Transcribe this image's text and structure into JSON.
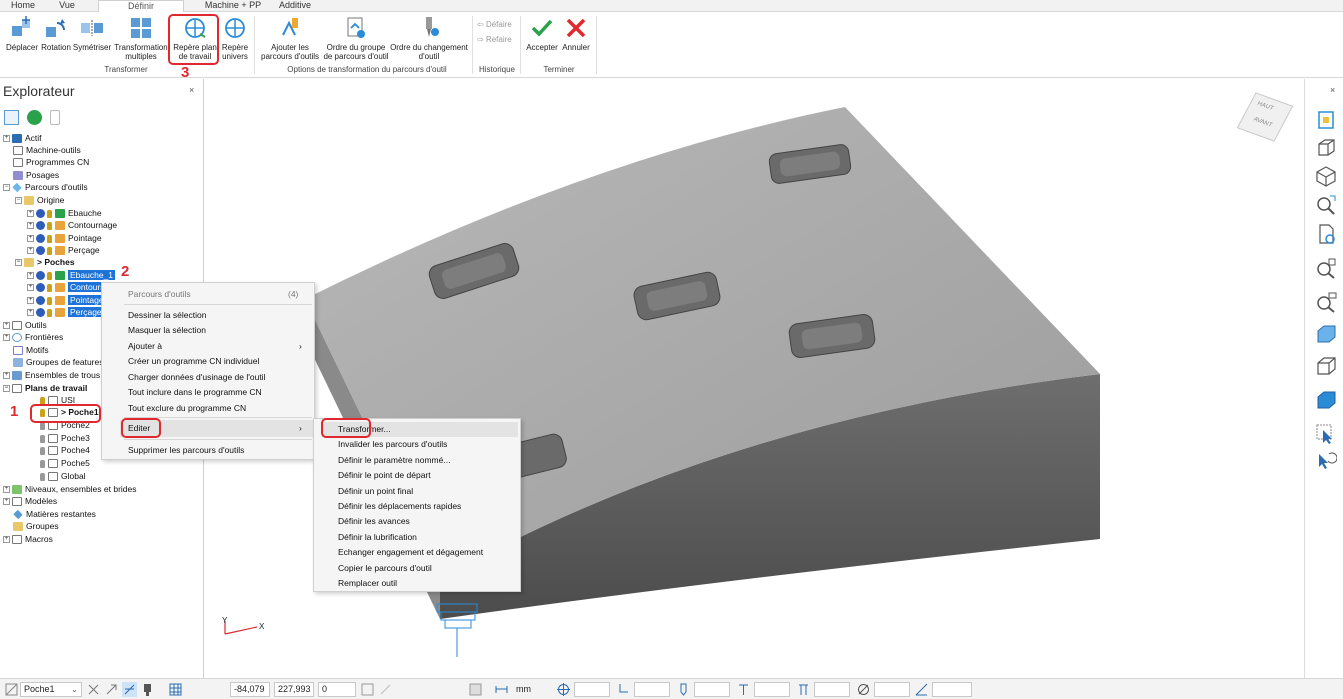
{
  "tabs": [
    {
      "label": "Home"
    },
    {
      "label": "Vue"
    },
    {
      "label": "Définir"
    },
    {
      "label": "Machine + PP"
    },
    {
      "label": "Additive"
    }
  ],
  "ribbon": {
    "buttons": [
      {
        "label": "Déplacer",
        "icon": "move-icon"
      },
      {
        "label": "Rotation",
        "icon": "rotate-icon"
      },
      {
        "label": "Symétriser",
        "icon": "mirror-icon"
      },
      {
        "label": "Transformation multiples",
        "icon": "multi-transform-icon"
      },
      {
        "label": "Repère plan de travail",
        "icon": "workplane-frame-icon"
      },
      {
        "label": "Repère univers",
        "icon": "world-frame-icon"
      },
      {
        "label": "Ajouter les parcours d'outils",
        "icon": "add-toolpaths-icon"
      },
      {
        "label": "Ordre du groupe de parcours d'outil",
        "icon": "group-order-icon"
      },
      {
        "label": "Ordre du changement d'outil",
        "icon": "tool-change-order-icon"
      },
      {
        "label": "Accepter",
        "icon": "check-icon"
      },
      {
        "label": "Annuler",
        "icon": "cancel-icon"
      }
    ],
    "history": {
      "undo": "Défaire",
      "redo": "Refaire"
    },
    "groups": {
      "transformer": "Transformer",
      "options": "Options de transformation du parcours d'outil",
      "historique": "Historique",
      "terminer": "Terminer"
    }
  },
  "explorer": {
    "title": "Explorateur",
    "close": "×",
    "tree": [
      {
        "label": "Actif"
      },
      {
        "label": "Machine-outils"
      },
      {
        "label": "Programmes CN"
      },
      {
        "label": "Posages"
      },
      {
        "label": "Parcours d'outils"
      },
      {
        "label": "Origine"
      },
      {
        "label": "Ebauche"
      },
      {
        "label": "Contournage"
      },
      {
        "label": "Pointage"
      },
      {
        "label": "Perçage"
      },
      {
        "label": "> Poches"
      },
      {
        "label": "Ebauche_1"
      },
      {
        "label": "Contournage_1"
      },
      {
        "label": "Pointage_1"
      },
      {
        "label": "Perçage_1"
      },
      {
        "label": "Outils"
      },
      {
        "label": "Frontières"
      },
      {
        "label": "Motifs"
      },
      {
        "label": "Groupes de features"
      },
      {
        "label": "Ensembles de trous"
      },
      {
        "label": "Plans de travail"
      },
      {
        "label": "USI"
      },
      {
        "label": "> Poche1"
      },
      {
        "label": "Poche2"
      },
      {
        "label": "Poche3"
      },
      {
        "label": "Poche4"
      },
      {
        "label": "Poche5"
      },
      {
        "label": "Global"
      },
      {
        "label": "Niveaux, ensembles et brides"
      },
      {
        "label": "Modèles"
      },
      {
        "label": "Matières restantes"
      },
      {
        "label": "Groupes"
      },
      {
        "label": "Macros"
      }
    ]
  },
  "context_menu": {
    "header": "Parcours d'outils",
    "count": "(4)",
    "items": [
      {
        "label": "Dessiner la sélection"
      },
      {
        "label": "Masquer la sélection"
      },
      {
        "label": "Ajouter à"
      },
      {
        "label": "Créer un programme CN individuel"
      },
      {
        "label": "Charger données d'usinage de l'outil"
      },
      {
        "label": "Tout inclure dans le programme CN"
      },
      {
        "label": "Tout exclure du programme CN"
      },
      {
        "label": "Editer"
      },
      {
        "label": "Supprimer les parcours d'outils"
      }
    ],
    "arrow": "›"
  },
  "submenu": {
    "items": [
      {
        "label": "Transformer..."
      },
      {
        "label": "Invalider les parcours d'outils"
      },
      {
        "label": "Définir le paramètre nommé..."
      },
      {
        "label": "Définir le point de départ"
      },
      {
        "label": "Définir un point final"
      },
      {
        "label": "Définir les déplacements rapides"
      },
      {
        "label": "Définir les avances"
      },
      {
        "label": "Définir la lubrification"
      },
      {
        "label": "Echanger engagement et dégagement"
      },
      {
        "label": "Copier le parcours d'outil"
      },
      {
        "label": "Remplacer outil"
      }
    ]
  },
  "callouts": {
    "n1": "1",
    "n2": "2",
    "n3": "3"
  },
  "viewcube": {
    "top": "HAUT",
    "front": "AVANT"
  },
  "axes": {
    "y": "Y",
    "x": "X"
  },
  "right_toolbar_close": "×",
  "statusbar": {
    "workplane": "Poche1",
    "coord_x": "-84,079",
    "coord_y": "227,993",
    "coord_z": "0",
    "unit": "mm"
  },
  "colors": {
    "accent": "#1e73d8",
    "callout": "#e0282e",
    "accept": "#2aa14b",
    "cancel": "#e0282e"
  }
}
